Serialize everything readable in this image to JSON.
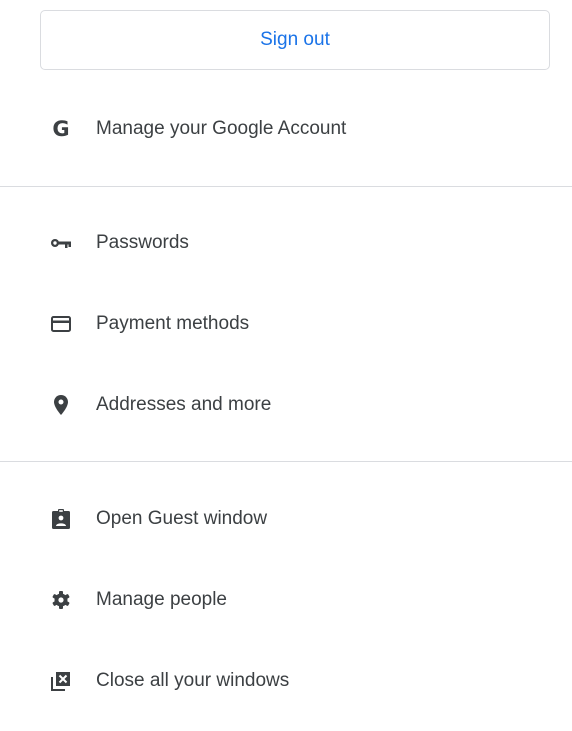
{
  "menu": {
    "sign_out_label": "Sign out",
    "account_item": {
      "label": "Manage your Google Account",
      "icon": "google-g-icon"
    },
    "autofill_items": [
      {
        "label": "Passwords",
        "icon": "key-icon"
      },
      {
        "label": "Payment methods",
        "icon": "credit-card-icon"
      },
      {
        "label": "Addresses and more",
        "icon": "location-pin-icon"
      }
    ],
    "profile_items": [
      {
        "label": "Open Guest window",
        "icon": "guest-badge-icon"
      },
      {
        "label": "Manage people",
        "icon": "gear-icon"
      },
      {
        "label": "Close all your windows",
        "icon": "close-windows-icon"
      }
    ]
  },
  "colors": {
    "accent": "#1a73e8",
    "text": "#3c4043",
    "divider": "#dadce0"
  }
}
